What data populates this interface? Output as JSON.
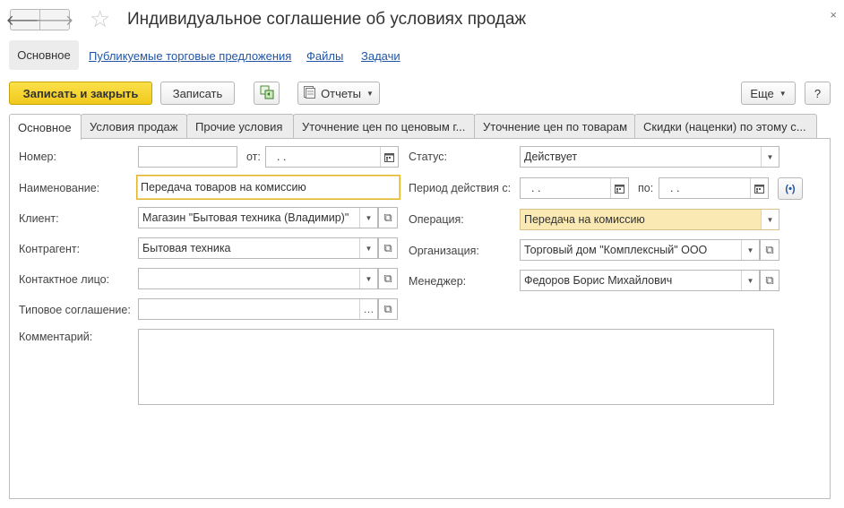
{
  "window": {
    "title": "Индивидуальное соглашение об условиях продаж",
    "back_glyph": "🡐",
    "forward_glyph": "🡒",
    "close_glyph": "×"
  },
  "top_nav": {
    "active": "Основное",
    "links": [
      "Публикуемые торговые предложения",
      "Файлы",
      "Задачи"
    ]
  },
  "toolbar": {
    "save_close": "Записать и закрыть",
    "save": "Записать",
    "reports": "Отчеты",
    "more": "Еще",
    "help": "?"
  },
  "tabs": [
    "Основное",
    "Условия продаж",
    "Прочие условия",
    "Уточнение цен по ценовым г...",
    "Уточнение цен по товарам",
    "Скидки (наценки) по этому с..."
  ],
  "form": {
    "number_label": "Номер:",
    "number_value": "",
    "from_label": "от:",
    "from_value": ".   .",
    "name_label": "Наименование:",
    "name_value": "Передача товаров на комиссию",
    "client_label": "Клиент:",
    "client_value": "Магазин \"Бытовая техника (Владимир)\"",
    "counterparty_label": "Контрагент:",
    "counterparty_value": "Бытовая техника",
    "contact_label": "Контактное лицо:",
    "contact_value": "",
    "template_label": "Типовое соглашение:",
    "template_value": "",
    "comment_label": "Комментарий:",
    "comment_value": "",
    "status_label": "Статус:",
    "status_value": "Действует",
    "period_label": "Период действия с:",
    "period_from_value": ".   .",
    "period_to_label": "по:",
    "period_to_value": ".   .",
    "operation_label": "Операция:",
    "operation_value": "Передача на комиссию",
    "organization_label": "Организация:",
    "organization_value": "Торговый дом \"Комплексный\" ООО",
    "manager_label": "Менеджер:",
    "manager_value": "Федоров Борис Михайлович"
  },
  "colors": {
    "primary_button": "#f0c91c",
    "link": "#2156a5",
    "highlight_field": "#fbe9b3"
  }
}
